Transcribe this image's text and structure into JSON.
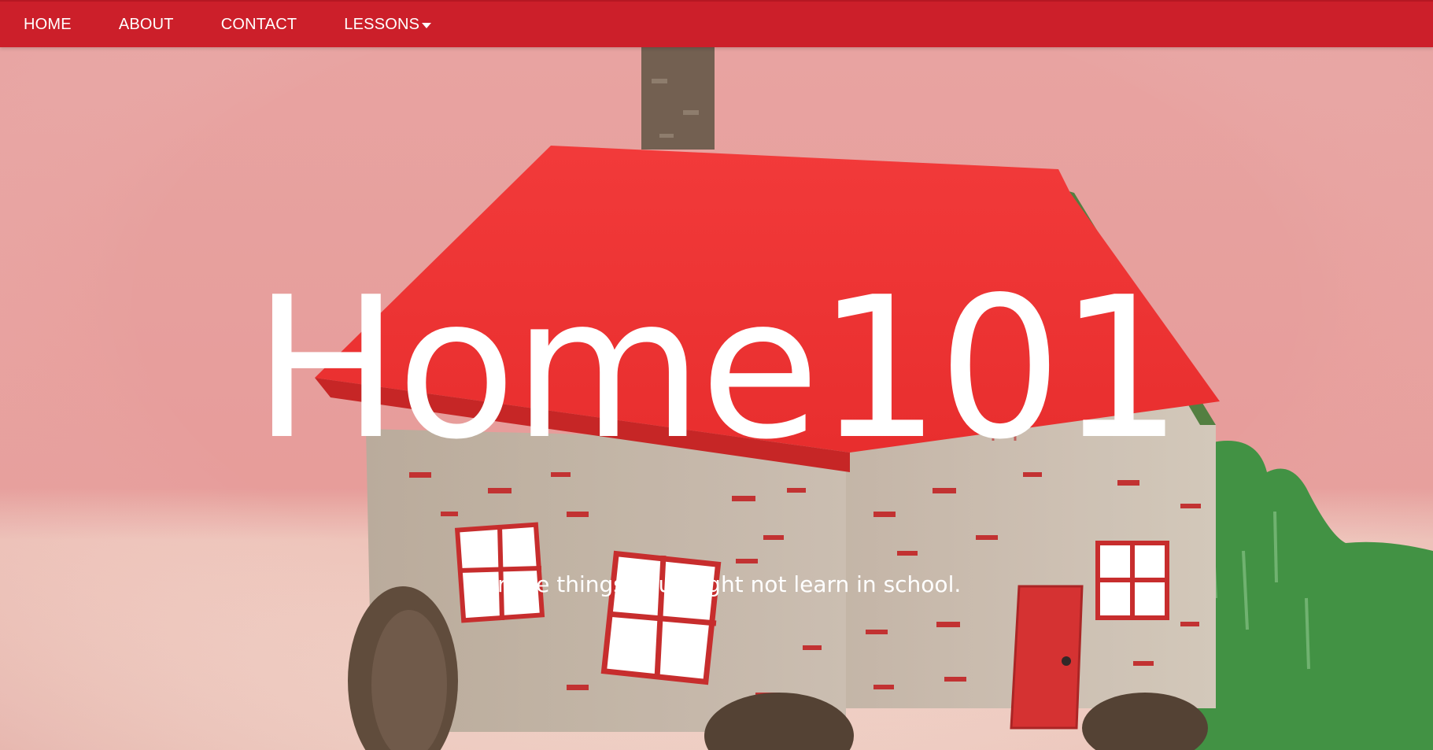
{
  "nav": {
    "items": [
      {
        "label": "HOME"
      },
      {
        "label": "ABOUT"
      },
      {
        "label": "CONTACT"
      },
      {
        "label": "LESSONS"
      }
    ]
  },
  "hero": {
    "title": "Home101",
    "subtitle": "For the things you might not learn in school.",
    "image_icon": "felt-house-illustration"
  },
  "colors": {
    "nav_background": "#cc1f2a",
    "nav_text": "#ffffff",
    "hero_text": "#ffffff",
    "roof": "#f0302f",
    "wall": "#c7b8a8",
    "bush": "#3a8a3a",
    "background": "#e9a3a2"
  }
}
